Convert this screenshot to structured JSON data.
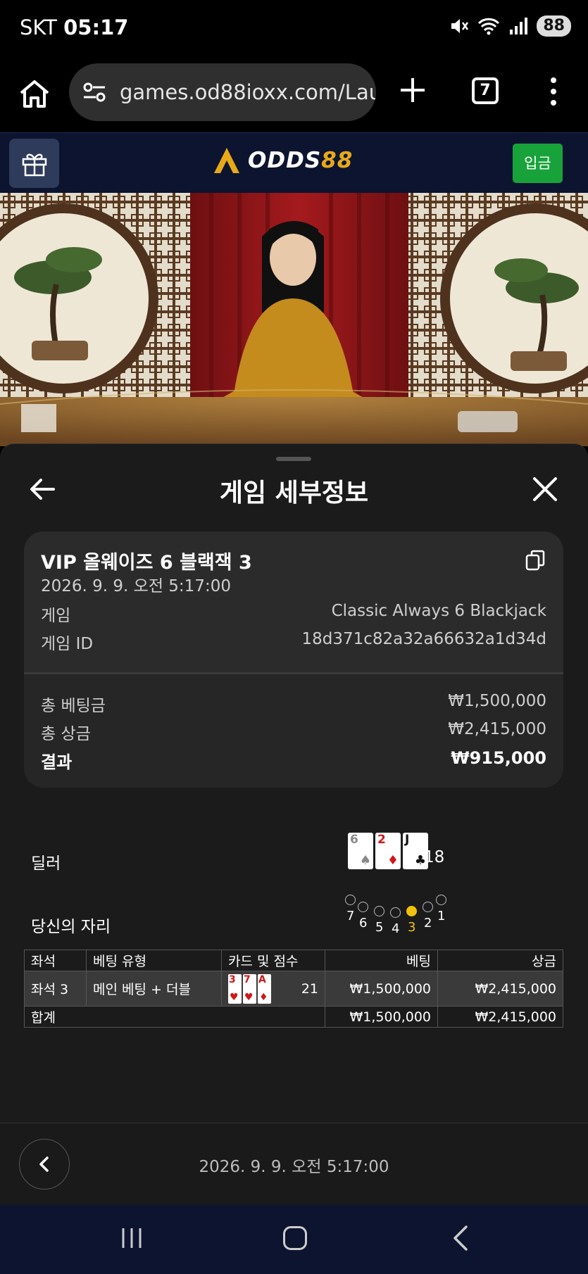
{
  "status": {
    "carrier": "SKT",
    "time": "05:17",
    "battery": "88"
  },
  "browser": {
    "url": "games.od88ioxx.com/Laun",
    "tab_count": "7"
  },
  "site": {
    "logo_white": "ODDS",
    "logo_gold": "88",
    "deposit_label": "입금"
  },
  "sheet": {
    "title": "게임 세부정보",
    "game_name": "VIP 올웨이즈 6 블랙잭 3",
    "game_datetime": "2026. 9. 9. 오전 5:17:00",
    "game_label": "게임",
    "game_value": "Classic Always 6 Blackjack",
    "game_id_label": "게임 ID",
    "game_id_value": "18d371c82a32a66632a1d34d",
    "total_bet_label": "총 베팅금",
    "total_bet_value": "₩1,500,000",
    "total_win_label": "총 상금",
    "total_win_value": "₩2,415,000",
    "result_label": "결과",
    "result_value": "₩915,000"
  },
  "dealer": {
    "label": "딜러",
    "cards": [
      {
        "rank": "6",
        "suit": "♠",
        "color": "#888888"
      },
      {
        "rank": "2",
        "suit": "♦",
        "color": "#d01818"
      },
      {
        "rank": "J",
        "suit": "♣",
        "color": "#111111"
      }
    ],
    "score": "18"
  },
  "seats": {
    "label": "당신의 자리",
    "numbers": [
      "7",
      "6",
      "5",
      "4",
      "3",
      "2",
      "1"
    ],
    "active": "3"
  },
  "table": {
    "headers": [
      "좌석",
      "베팅 유형",
      "카드 및 점수",
      "베팅",
      "상금"
    ],
    "row": {
      "seat": "좌석 3",
      "bet_type": "메인 베팅 + 더블",
      "cards": [
        {
          "rank": "3",
          "suit": "♥",
          "color": "#d01818"
        },
        {
          "rank": "7",
          "suit": "♥",
          "color": "#d01818"
        },
        {
          "rank": "A",
          "suit": "♦",
          "color": "#d01818"
        }
      ],
      "score": "21",
      "bet": "₩1,500,000",
      "win": "₩2,415,000"
    },
    "total": {
      "label": "합계",
      "bet": "₩1,500,000",
      "win": "₩2,415,000"
    }
  },
  "footer": {
    "datetime": "2026. 9. 9. 오전 5:17:00"
  },
  "colors": {
    "accent_gold": "#e8a919",
    "deposit_green": "#18a33a",
    "active_seat": "#f0c20c",
    "header_navy": "#0c1430"
  }
}
